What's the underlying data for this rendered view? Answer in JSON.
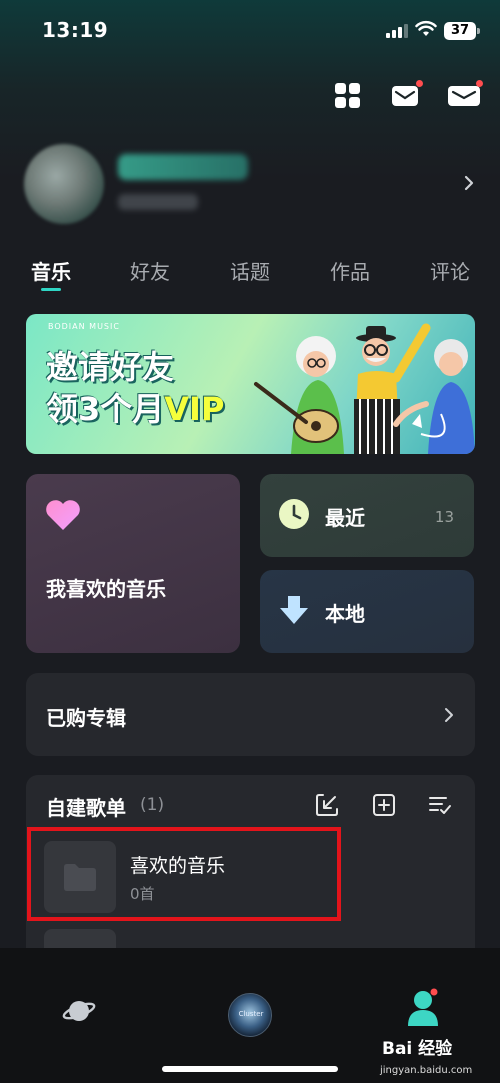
{
  "status_bar": {
    "time": "13:19",
    "battery": "37"
  },
  "tabs": [
    {
      "label": "音乐",
      "active": true
    },
    {
      "label": "好友",
      "active": false
    },
    {
      "label": "话题",
      "active": false
    },
    {
      "label": "作品",
      "active": false
    },
    {
      "label": "评论",
      "active": false
    }
  ],
  "banner": {
    "brand": "BODIAN MUSIC",
    "line1": "邀请好友",
    "line2_prefix": "领3个月",
    "line2_highlight": "VIP"
  },
  "tiles": {
    "favorite": {
      "label": "我喜欢的音乐",
      "icon": "heart-icon"
    },
    "recent": {
      "label": "最近",
      "count": "13",
      "icon": "clock-icon"
    },
    "local": {
      "label": "本地",
      "icon": "download-icon"
    }
  },
  "purchased": {
    "label": "已购专辑"
  },
  "playlists": {
    "title": "自建歌单",
    "count": "(1)",
    "items": [
      {
        "name": "喜欢的音乐",
        "songs": "0首"
      }
    ]
  },
  "bottom_nav": {
    "disc_text": "Cluster"
  },
  "watermark": {
    "main": "Bai 经验",
    "sub": "jingyan.baidu.com"
  },
  "colors": {
    "accent": "#2fd5c4",
    "highlight_box": "#e3141b",
    "notification_dot": "#ff4d4f"
  }
}
